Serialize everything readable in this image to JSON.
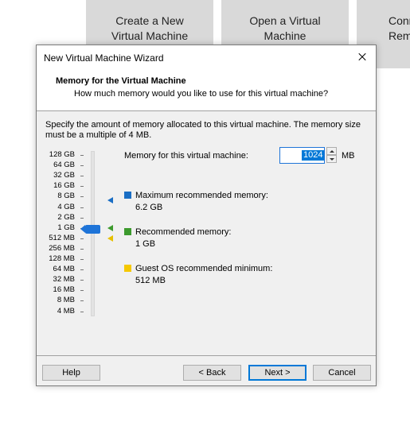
{
  "background_tiles": [
    {
      "line1": "Create a New",
      "line2": "Virtual Machine"
    },
    {
      "line1": "Open a Virtual",
      "line2": "Machine"
    },
    {
      "line1": "Conn",
      "line2": "Remo"
    }
  ],
  "dialog": {
    "title": "New Virtual Machine Wizard",
    "header_title": "Memory for the Virtual Machine",
    "header_subtitle": "How much memory would you like to use for this virtual machine?",
    "intro_line1": "Specify the amount of memory allocated to this virtual machine. The memory size",
    "intro_line2": "must be a multiple of 4 MB."
  },
  "memory": {
    "label": "Memory for this virtual machine:",
    "value": "1024",
    "unit": "MB"
  },
  "slider": {
    "ticks": [
      "128 GB",
      "64 GB",
      "32 GB",
      "16 GB",
      "8 GB",
      "4 GB",
      "2 GB",
      "1 GB",
      "512 MB",
      "256 MB",
      "128 MB",
      "64 MB",
      "32 MB",
      "16 MB",
      "8 MB",
      "4 MB"
    ],
    "selected": "1 GB"
  },
  "legend": {
    "maximum": {
      "title": "Maximum recommended memory:",
      "value": "6.2 GB",
      "color": "#1a6ec4"
    },
    "recommended": {
      "title": "Recommended memory:",
      "value": "1 GB",
      "color": "#3c9a2d"
    },
    "guest_minimum": {
      "title": "Guest OS recommended minimum:",
      "value": "512 MB",
      "color": "#f5c800"
    }
  },
  "buttons": {
    "help": "Help",
    "back": "< Back",
    "next": "Next >",
    "cancel": "Cancel"
  }
}
